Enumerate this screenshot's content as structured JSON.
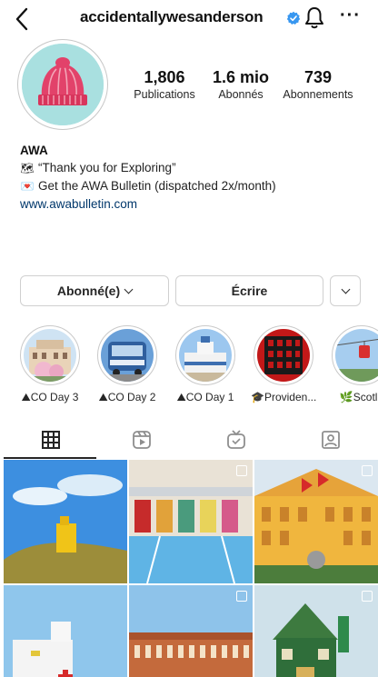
{
  "header": {
    "username": "accidentallywesanderson",
    "back_icon": "chevron-left-icon",
    "verified_icon": "verified-badge-icon",
    "notify_icon": "bell-icon",
    "more_label": "···"
  },
  "profile": {
    "avatar_icon": "knit-beanie-avatar",
    "stats": [
      {
        "value": "1,806",
        "label": "Publications"
      },
      {
        "value": "1.6 mio",
        "label": "Abonnés"
      },
      {
        "value": "739",
        "label": "Abonnements"
      }
    ],
    "bio": {
      "name": "AWA",
      "line1": "“Thank you for Exploring”",
      "line1_emoji": "🗺",
      "line2": "Get the AWA Bulletin (dispatched 2x/month)",
      "line2_emoji": "💌",
      "link": "www.awabulletin.com"
    }
  },
  "actions": {
    "follow_label": "Abonné(e)",
    "message_label": "Écrire"
  },
  "highlights": [
    {
      "label": "CO Day 3",
      "emoji": "⛰"
    },
    {
      "label": "CO Day 2",
      "emoji": "⛰"
    },
    {
      "label": "CO Day 1",
      "emoji": "⛰"
    },
    {
      "label": "Providen...",
      "emoji": "🎓"
    },
    {
      "label": "Scotla",
      "emoji": "🌿"
    }
  ],
  "tabs": [
    {
      "name": "grid",
      "icon": "grid-icon",
      "active": true
    },
    {
      "name": "reels",
      "icon": "reels-icon",
      "active": false
    },
    {
      "name": "igtv",
      "icon": "igtv-icon",
      "active": false
    },
    {
      "name": "tagged",
      "icon": "tagged-icon",
      "active": false
    }
  ],
  "colors": {
    "link": "#00376b",
    "verified": "#3897f0",
    "avatar_bg": "#a9e0e0",
    "beanie": "#e2426a"
  }
}
